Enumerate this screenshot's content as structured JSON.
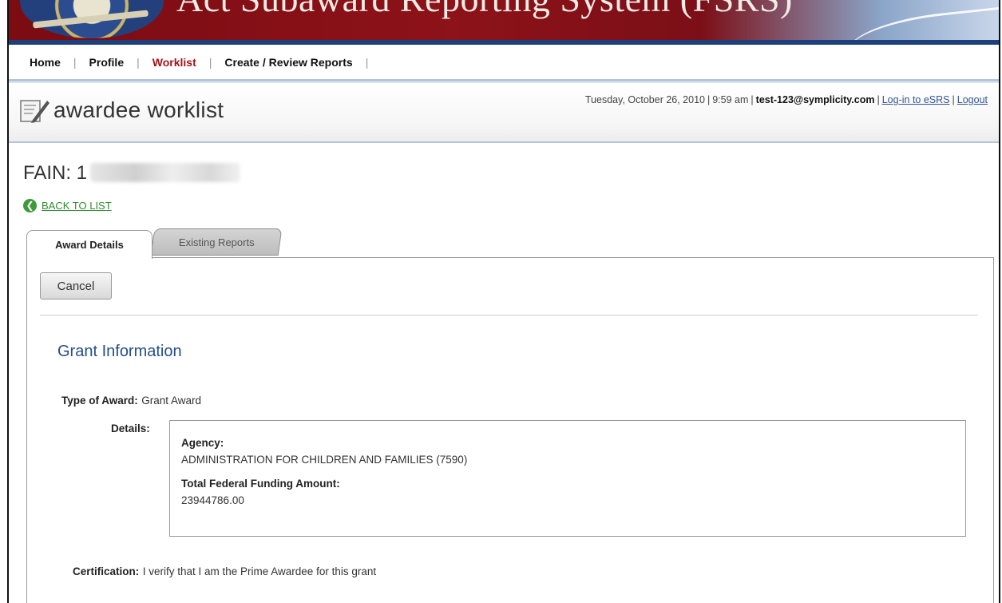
{
  "header": {
    "title": "Act Subaward Reporting System (FSRS)"
  },
  "nav": {
    "items": [
      {
        "label": "Home",
        "active": false
      },
      {
        "label": "Profile",
        "active": false
      },
      {
        "label": "Worklist",
        "active": true
      },
      {
        "label": "Create / Review Reports",
        "active": false
      }
    ],
    "separator": "|"
  },
  "page": {
    "title": "awardee worklist",
    "date": "Tuesday, October 26, 2010",
    "time": "9:59 am",
    "user_email": "test-123@symplicity.com",
    "login_link": "Log-in to eSRS",
    "logout_link": "Logout"
  },
  "fain": {
    "label": "FAIN: 1"
  },
  "back_link": "BACK TO LIST",
  "tabs": [
    {
      "label": "Award Details",
      "active": true
    },
    {
      "label": "Existing Reports",
      "active": false
    }
  ],
  "actions": {
    "cancel_label": "Cancel"
  },
  "grant": {
    "section_title": "Grant Information",
    "type_label": "Type of Award:",
    "type_value": "Grant Award",
    "details_label": "Details:",
    "agency_label": "Agency:",
    "agency_value": "ADMINISTRATION FOR CHILDREN AND FAMILIES (7590)",
    "funding_label": "Total Federal Funding Amount:",
    "funding_value": "23944786.00",
    "cert_label": "Certification:",
    "cert_value": "I verify that I am the Prime Awardee for this grant"
  },
  "colors": {
    "banner_red": "#7a0c12",
    "active_nav": "#a3141c",
    "section_blue": "#23508a",
    "link_green": "#2f8a2f"
  },
  "icons": {
    "page_icon": "notepad-pencil-icon",
    "back_icon": "back-arrow-circle-icon"
  }
}
